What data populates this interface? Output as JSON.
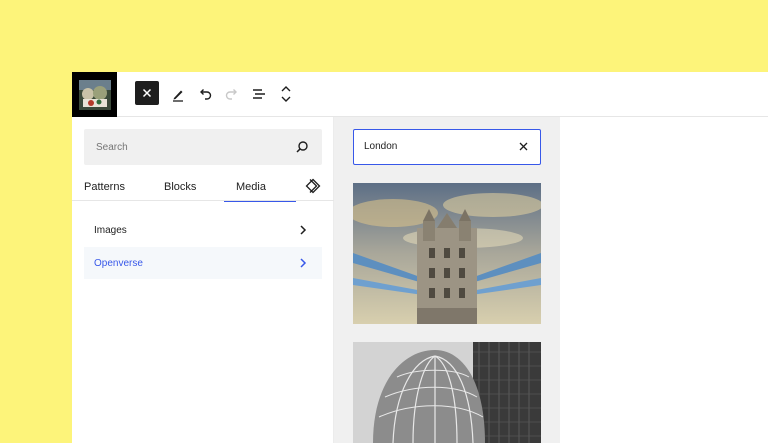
{
  "sidebar": {
    "search": {
      "placeholder": "Search"
    },
    "tabs": [
      {
        "label": "Patterns"
      },
      {
        "label": "Blocks"
      },
      {
        "label": "Media"
      }
    ],
    "active_tab": "Media",
    "categories": [
      {
        "label": "Images"
      },
      {
        "label": "Openverse"
      }
    ]
  },
  "panel": {
    "search_value": "London"
  },
  "colors": {
    "background": "#fdf47a",
    "accent": "#3858e9",
    "panel": "#f0f0f0"
  },
  "icons": {
    "toolbar": [
      "close-icon",
      "pen-icon",
      "undo-icon",
      "redo-icon",
      "list-view-icon",
      "chevron-up-down-icon"
    ],
    "search": "search-icon",
    "tab_extra": "diamond-icon",
    "chevron": "chevron-right-icon",
    "clear": "close-icon"
  }
}
